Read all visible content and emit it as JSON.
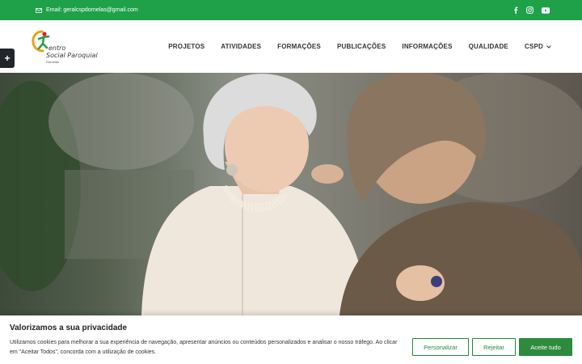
{
  "topbar": {
    "email": "Email: geralcspdornelas@gmail.com",
    "socials": [
      "facebook-icon",
      "instagram-icon",
      "youtube-icon"
    ]
  },
  "logo": {
    "line1": "entro",
    "line2": "Social Paroquial",
    "line3": "Dornelas"
  },
  "nav": {
    "items": [
      "PROJETOS",
      "ATIVIDADES",
      "FORMAÇÕES",
      "PUBLICAÇÕES",
      "INFORMAÇÕES",
      "QUALIDADE",
      "CSPD"
    ]
  },
  "side_toggle": "+",
  "hero": {
    "image_icon": "hero-photo-elderly-care"
  },
  "cookie": {
    "title": "Valorizamos a sua privacidade",
    "text": "Utilizamos cookies para melhorar a sua experiência de navegação, apresentar anúncios ou conteúdos personalizados e analisar o nosso tráfego. Ao clicar em \"Aceitar Todos\", concorda com a utilização de cookies.",
    "customize": "Personalizar",
    "reject": "Rejeitar",
    "accept": "Aceite tudo"
  },
  "colors": {
    "brand_green": "#1fa149",
    "button_green": "#2e8b3d"
  }
}
